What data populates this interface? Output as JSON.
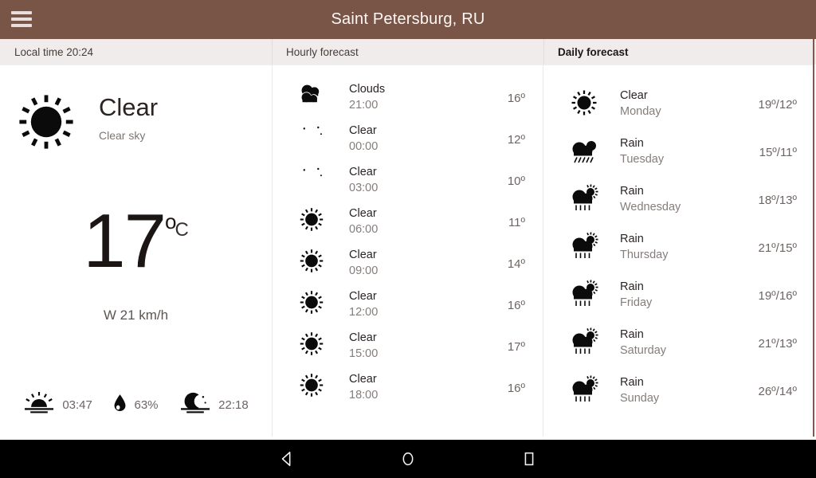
{
  "appbar": {
    "menu_icon": "hamburger-menu-icon",
    "title": "Saint Petersburg, RU"
  },
  "tabs": [
    {
      "label": "Local time 20:24",
      "name": "tab-local-time",
      "active": false
    },
    {
      "label": "Hourly forecast",
      "name": "tab-hourly-forecast",
      "active": false
    },
    {
      "label": "Daily forecast",
      "name": "tab-daily-forecast",
      "active": true
    }
  ],
  "current": {
    "icon": "sun-icon",
    "condition": "Clear",
    "description": "Clear sky",
    "temperature": "17",
    "degree_symbol": "o",
    "unit": "C",
    "wind": "W 21 km/h",
    "stats": [
      {
        "icon": "sunrise-icon",
        "name": "sunrise",
        "value": "03:47"
      },
      {
        "icon": "humidity-drop-icon",
        "name": "humidity",
        "value": "63%"
      },
      {
        "icon": "moonset-icon",
        "name": "moonset",
        "value": "22:18"
      }
    ]
  },
  "hourly": [
    {
      "icon": "clouds-icon",
      "condition": "Clouds",
      "time": "21:00",
      "temp": "16º"
    },
    {
      "icon": "moon-icon",
      "condition": "Clear",
      "time": "00:00",
      "temp": "12º"
    },
    {
      "icon": "moon-icon",
      "condition": "Clear",
      "time": "03:00",
      "temp": "10º"
    },
    {
      "icon": "sun-icon",
      "condition": "Clear",
      "time": "06:00",
      "temp": "11º"
    },
    {
      "icon": "sun-icon",
      "condition": "Clear",
      "time": "09:00",
      "temp": "14º"
    },
    {
      "icon": "sun-icon",
      "condition": "Clear",
      "time": "12:00",
      "temp": "16º"
    },
    {
      "icon": "sun-icon",
      "condition": "Clear",
      "time": "15:00",
      "temp": "17º"
    },
    {
      "icon": "sun-icon",
      "condition": "Clear",
      "time": "18:00",
      "temp": "16º"
    }
  ],
  "daily": [
    {
      "icon": "sun-icon",
      "condition": "Clear",
      "day": "Monday",
      "temp": "19º/12º"
    },
    {
      "icon": "rain-moon-icon",
      "condition": "Rain",
      "day": "Tuesday",
      "temp": "15º/11º"
    },
    {
      "icon": "rain-sun-icon",
      "condition": "Rain",
      "day": "Wednesday",
      "temp": "18º/13º"
    },
    {
      "icon": "rain-sun-icon",
      "condition": "Rain",
      "day": "Thursday",
      "temp": "21º/15º"
    },
    {
      "icon": "rain-sun-icon",
      "condition": "Rain",
      "day": "Friday",
      "temp": "19º/16º"
    },
    {
      "icon": "rain-sun-icon",
      "condition": "Rain",
      "day": "Saturday",
      "temp": "21º/13º"
    },
    {
      "icon": "rain-sun-icon",
      "condition": "Rain",
      "day": "Sunday",
      "temp": "26º/14º"
    }
  ],
  "navbar": [
    {
      "name": "nav-back-button",
      "icon": "back-triangle-icon"
    },
    {
      "name": "nav-home-button",
      "icon": "home-circle-icon"
    },
    {
      "name": "nav-recents-button",
      "icon": "recents-square-icon"
    }
  ],
  "colors": {
    "appbar": "#795548",
    "tabstrip": "#f0eceb",
    "navbar": "#000000",
    "text_primary": "#2b2423",
    "text_secondary": "#857d7a"
  }
}
